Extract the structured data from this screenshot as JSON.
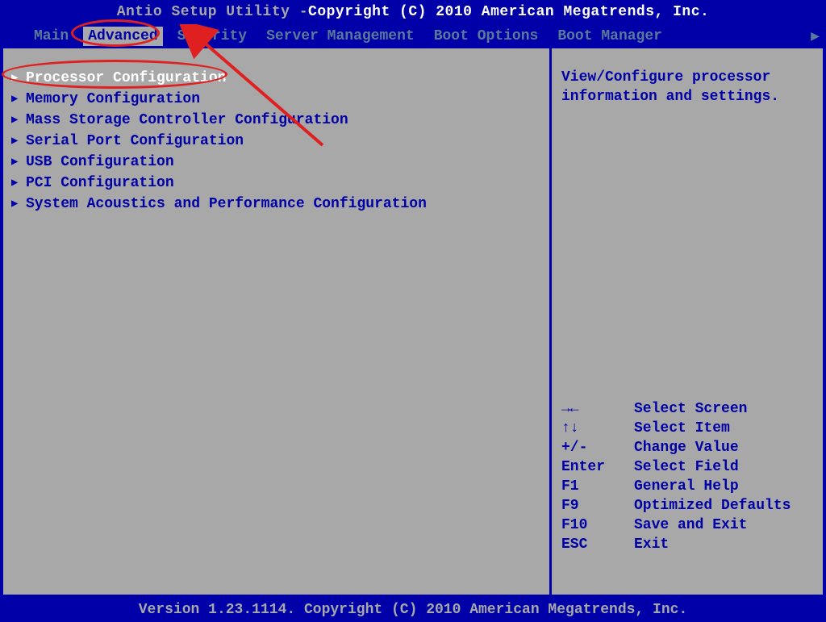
{
  "header": {
    "title_prefix": "Antio Setup Utility - ",
    "title_copyright": "Copyright (C) 2010 American Megatrends, Inc."
  },
  "tabs": {
    "items": [
      {
        "label": "Main"
      },
      {
        "label": "Advanced",
        "active": true
      },
      {
        "label": "Security"
      },
      {
        "label": "Server Management"
      },
      {
        "label": "Boot Options"
      },
      {
        "label": "Boot Manager"
      }
    ]
  },
  "menu": {
    "items": [
      {
        "label": "Processor Configuration",
        "selected": true
      },
      {
        "label": "Memory Configuration"
      },
      {
        "label": "Mass Storage Controller Configuration"
      },
      {
        "label": "Serial Port Configuration"
      },
      {
        "label": "USB Configuration"
      },
      {
        "label": "PCI Configuration"
      },
      {
        "label": "System Acoustics and Performance Configuration"
      }
    ]
  },
  "help": {
    "line1": "View/Configure processor",
    "line2": "information and settings."
  },
  "keys": [
    {
      "key": "→←",
      "desc": "Select Screen"
    },
    {
      "key": "↑↓",
      "desc": "Select Item"
    },
    {
      "key": "+/-",
      "desc": "Change Value"
    },
    {
      "key": "Enter",
      "desc": "Select Field"
    },
    {
      "key": "F1",
      "desc": "General Help"
    },
    {
      "key": "F9",
      "desc": "Optimized Defaults"
    },
    {
      "key": "F10",
      "desc": "Save and Exit"
    },
    {
      "key": "ESC",
      "desc": "Exit"
    }
  ],
  "footer": {
    "text": "Version 1.23.1114. Copyright (C) 2010 American Megatrends, Inc."
  },
  "annotations": {
    "circles": [
      "tab-advanced",
      "menu-processor-configuration"
    ],
    "arrow_target": "menu-processor-configuration"
  }
}
